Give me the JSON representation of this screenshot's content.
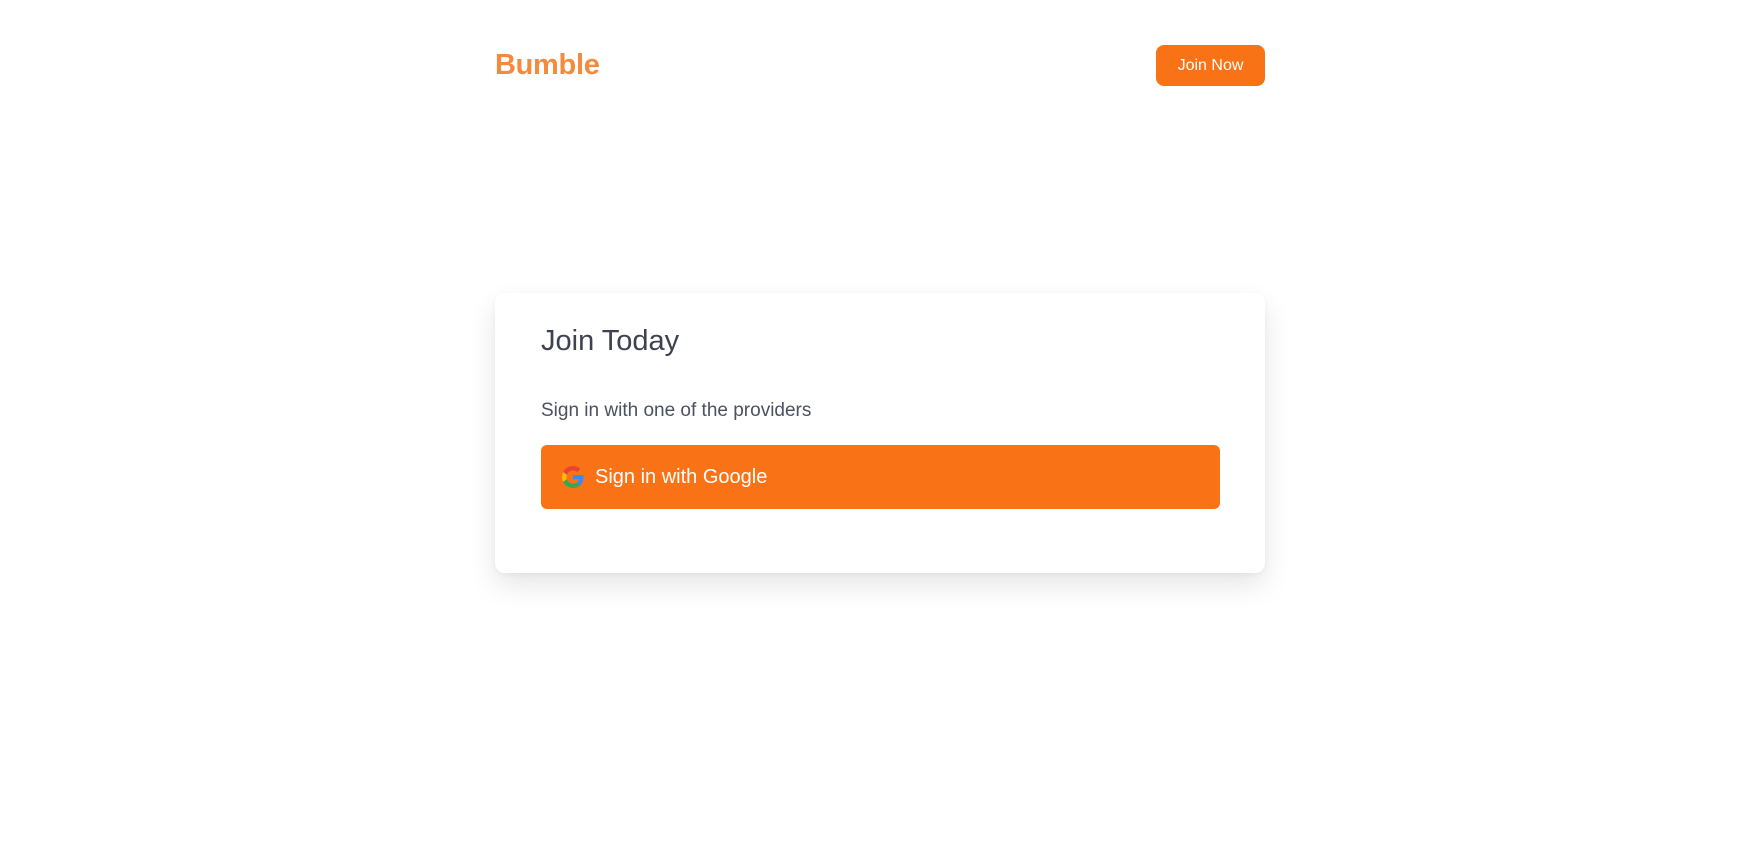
{
  "header": {
    "logo": "Bumble",
    "join_now_label": "Join Now"
  },
  "card": {
    "title": "Join Today",
    "subtitle": "Sign in with one of the providers",
    "google_button_label": "Sign in with Google"
  },
  "icons": {
    "google": "google-icon"
  },
  "colors": {
    "brand": "#f97316",
    "logo": "#f58a3c",
    "title_text": "#3d4151"
  }
}
